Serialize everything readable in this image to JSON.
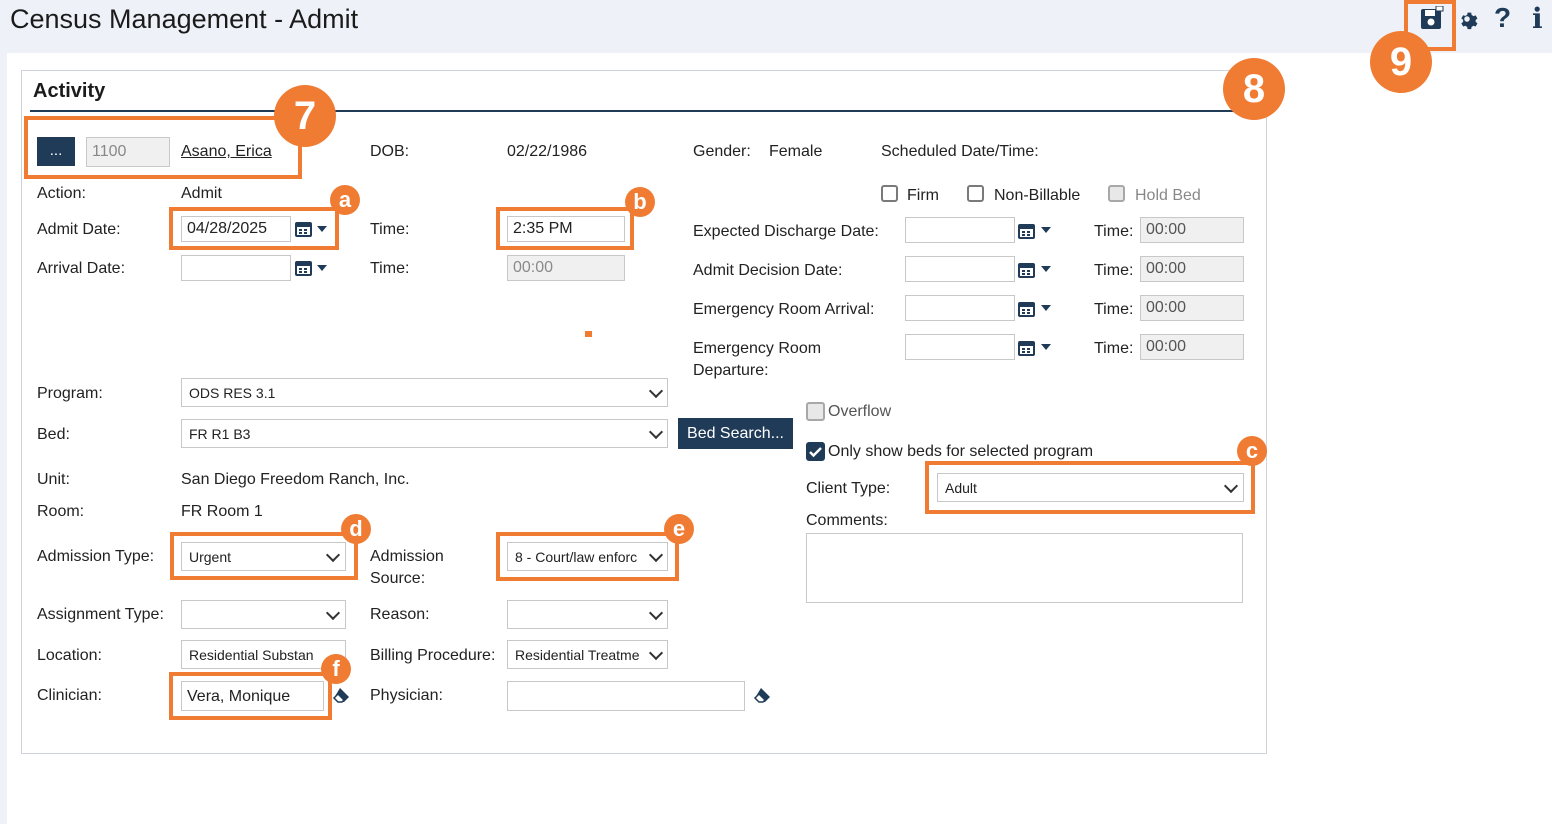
{
  "window": {
    "title": "Census Management - Admit"
  },
  "toolbar": {
    "save_icon": "save-icon",
    "settings_icon": "gear-icon",
    "help_icon": "question-icon",
    "info_icon": "info-icon"
  },
  "section": {
    "title": "Activity"
  },
  "client": {
    "lookup_label": "...",
    "id": "1100",
    "name": "Asano, Erica",
    "dob_label": "DOB:",
    "dob": "02/22/1986",
    "gender_label": "Gender:",
    "gender": "Female",
    "scheduled_label": "Scheduled Date/Time:"
  },
  "form": {
    "action_label": "Action:",
    "action": "Admit",
    "admit_date_label": "Admit Date:",
    "admit_date": "04/28/2025",
    "time_label": "Time:",
    "admit_time": "2:35 PM",
    "arrival_date_label": "Arrival Date:",
    "arrival_date": "",
    "arrival_time": "00:00",
    "program_label": "Program:",
    "program": "ODS RES 3.1",
    "bed_label": "Bed:",
    "bed": "FR R1 B3",
    "bed_search_label": "Bed Search...",
    "unit_label": "Unit:",
    "unit": "San Diego Freedom Ranch, Inc.",
    "room_label": "Room:",
    "room": "FR Room 1",
    "admission_type_label": "Admission Type:",
    "admission_type": "Urgent",
    "admission_source_label_1": "Admission",
    "admission_source_label_2": "Source:",
    "admission_source": "8 - Court/law enforc",
    "assignment_type_label": "Assignment Type:",
    "assignment_type": "",
    "reason_label": "Reason:",
    "reason": "",
    "location_label": "Location:",
    "location": "Residential Substan",
    "billing_label": "Billing Procedure:",
    "billing": "Residential Treatme",
    "clinician_label": "Clinician:",
    "clinician": "Vera, Monique",
    "physician_label": "Physician:",
    "physician": ""
  },
  "right": {
    "firm_label": "Firm",
    "non_billable_label": "Non-Billable",
    "hold_bed_label": "Hold Bed",
    "expected_discharge_label": "Expected Discharge Date:",
    "admit_decision_label": "Admit Decision Date:",
    "er_arrival_label": "Emergency Room Arrival:",
    "er_departure_label_1": "Emergency Room",
    "er_departure_label_2": "Departure:",
    "time_label": "Time:",
    "time_default": "00:00",
    "overflow_label": "Overflow",
    "only_show_beds_label": "Only show beds for selected program",
    "client_type_label": "Client Type:",
    "client_type": "Adult",
    "comments_label": "Comments:"
  },
  "callouts": {
    "n7": "7",
    "n8": "8",
    "n9": "9",
    "a": "a",
    "b": "b",
    "c": "c",
    "d": "d",
    "e": "e",
    "f": "f"
  },
  "colors": {
    "accent": "#f07c34",
    "primary": "#1f3b57"
  }
}
